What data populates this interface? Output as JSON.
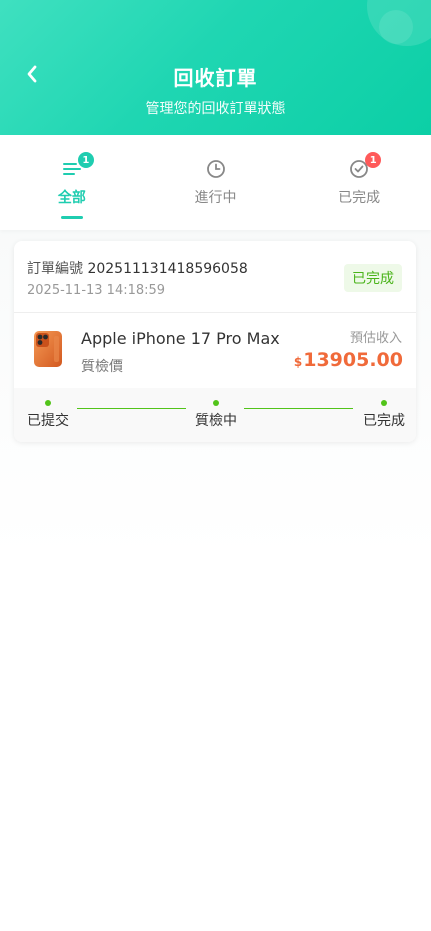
{
  "header": {
    "title": "回收訂單",
    "subtitle": "管理您的回收訂單狀態"
  },
  "tabs": [
    {
      "label": "全部",
      "badge": "1",
      "icon": "list-icon",
      "active": true
    },
    {
      "label": "進行中",
      "badge": "",
      "icon": "clock-icon",
      "active": false
    },
    {
      "label": "已完成",
      "badge": "1",
      "icon": "check-circle-icon",
      "active": false
    }
  ],
  "order": {
    "number_label": "訂單編號",
    "number": "202511131418596058",
    "time": "2025-11-13 14:18:59",
    "status": "已完成",
    "product_name": "Apple iPhone 17 Pro Max",
    "price_type": "質檢價",
    "estimate_label": "預估收入",
    "currency": "$",
    "estimate_amount": "13905.00",
    "steps": [
      "已提交",
      "質檢中",
      "已完成"
    ]
  },
  "colors": {
    "accent": "#1fcdb0",
    "status_green": "#52c41a",
    "price_orange": "#f06a3a",
    "badge_teal": "#1fcdb0",
    "badge_red": "#ff5a5a"
  }
}
